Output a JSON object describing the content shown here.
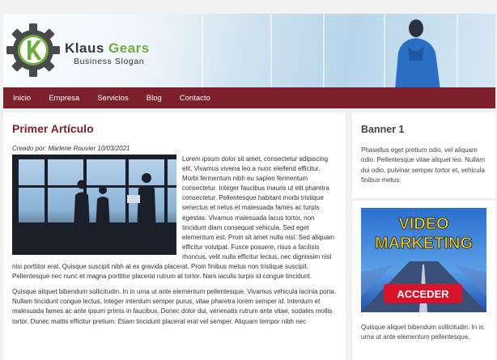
{
  "header": {
    "brand_part1": "Klaus",
    "brand_part2": "Gears",
    "slogan": "Business Slogan"
  },
  "nav": {
    "items": [
      "Inicio",
      "Empresa",
      "Servicios",
      "Blog",
      "Contacto"
    ]
  },
  "post": {
    "title": "Primer Artículo",
    "meta": "Creado por: Marlene Rouvier 10/03/2021",
    "paragraph1": "Lorem ipsum dolor sit amet, consectetur adipiscing elit. Vivamus viverra leo a nunc eleifend efficitur. Morbi fermentum nibh eu sapien fermentum consectetur. Integer faucibus mauris ut elit pharetra consectetur. Pellentesque habitant morbi tristique senectus et netus et malesuada fames ac turpis egestas. Vivamus malesuada lacus tortor, non tincidunt diam consequat vehicula. Sed eget elementum est. Proin sit amet nulla nisl. Sed aliquam efficitur volutpat. Fusce posuere, risus a facilisis rhoncus, velit nulla efficitur lectus, nec dignissim nisl nisi porttitor erat. Quisque suscipit nibh at ex gravida placerat. Proin finibus metus non tristique suscipit. Pellentesque nec nunc et magna porttitor placerat rutrum at tortor. Nam iaculis turpis id congue tincidunt.",
    "paragraph2": "Quisque aliquet bibendum sollicitudin. In in urna ut ante elementum pellentesque. Vivamus vehicula lacinia porta. Nullam tincidunt congue lectus. Integer interdum semper purus, vitae pharetra lorem semper id. Interdum et malesuada fames ac ante ipsum primis in faucibus. Donec dolor dui, venenatis rutrum ante vitae, sodales mollis tortor. Donec mattis efficitur pretium. Etiam tincidunt placerat erat vel semper. Aliquam tempor nibh nec"
  },
  "sidebar": {
    "banner_title": "Banner 1",
    "banner_text": "Phasellus eget pretium odio, vel aliquam odio. Pellentesque vitae aliquet leo. Nullam dui odio, pulvinar semper tortor et, vehicula finibus metus.",
    "ad": {
      "line1": "VIDEO",
      "line2": "MARKETING",
      "button": "ACCEDER"
    },
    "widget2_text": "Quisque aliquet bibendum sollicitudin. In in urna ut ante elementum pellentesque."
  },
  "colors": {
    "accent": "#7e1f2d",
    "brand_green": "#6cae3c",
    "ad_yellow": "#f5d21c",
    "ad_red": "#d8142a"
  },
  "icons": {
    "logo": "gear-k-logo-icon"
  }
}
